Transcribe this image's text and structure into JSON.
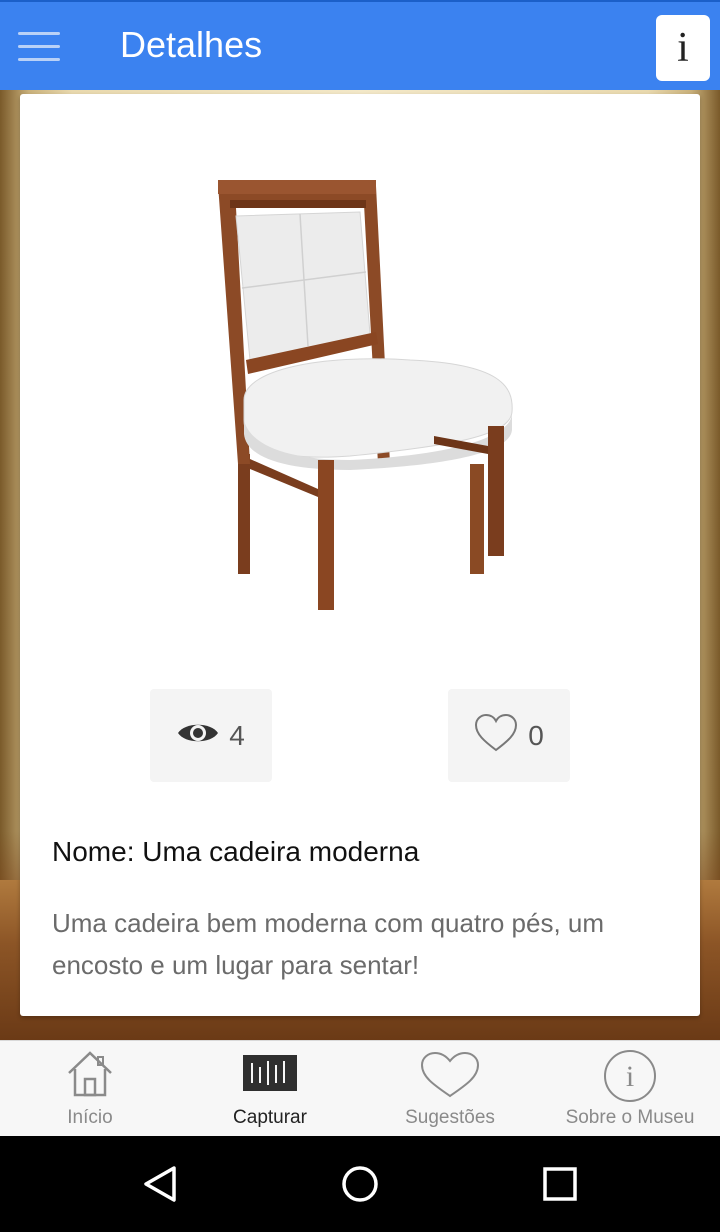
{
  "header": {
    "title": "Detalhes",
    "info_label": "i"
  },
  "item": {
    "views": "4",
    "likes": "0",
    "name": "Nome: Uma cadeira moderna",
    "description": "Uma cadeira bem moderna com quatro pés, um encosto e um lugar para sentar!"
  },
  "bottom_nav": {
    "items": [
      {
        "label": "Início",
        "icon": "home-icon"
      },
      {
        "label": "Capturar",
        "icon": "barcode-icon",
        "active": true
      },
      {
        "label": "Sugestões",
        "icon": "heart-icon"
      },
      {
        "label": "Sobre o Museu",
        "icon": "info-circle-icon"
      }
    ]
  },
  "colors": {
    "app_bar": "#3b82f0",
    "card": "#ffffff",
    "stat_box": "#f4f4f4",
    "nav_background": "#f7f7f7"
  }
}
